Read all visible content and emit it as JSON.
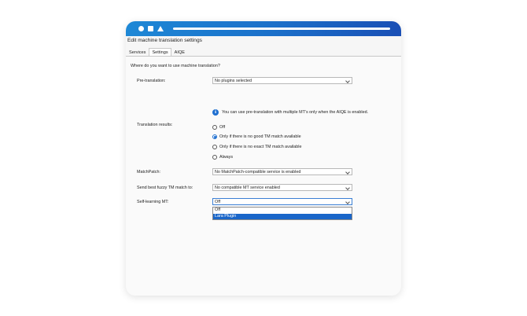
{
  "window": {
    "title": "Edit machine translation settings"
  },
  "tabs": [
    {
      "label": "Services"
    },
    {
      "label": "Settings"
    },
    {
      "label": "AIQE"
    }
  ],
  "question": "Where do you want to use machine translation?",
  "pretranslation": {
    "label": "Pre-translation:",
    "value": "No plugins selected"
  },
  "info": {
    "text": "You can use pre-translation with multiple MT’s only when the AIQE is enabled."
  },
  "translation_results": {
    "label": "Translation results:",
    "options": [
      {
        "label": "Off",
        "checked": false
      },
      {
        "label": "Only if there is no good TM match available",
        "checked": true
      },
      {
        "label": "Only if there is no exact TM match available",
        "checked": false
      },
      {
        "label": "Always",
        "checked": false
      }
    ]
  },
  "matchpatch": {
    "label": "MatchPatch:",
    "value": "No MatchPatch-compatible service is enabled"
  },
  "send_best_fuzzy": {
    "label": "Send best fuzzy TM match to:",
    "value": "No compatible MT service enabled"
  },
  "self_learning": {
    "label": "Self-learning MT:",
    "value": "Off",
    "options": [
      "Off",
      "Lara Plugin"
    ],
    "highlighted": "Lara Plugin"
  },
  "colors": {
    "titlebar_start": "#1e88d6",
    "titlebar_end": "#1a4fb5",
    "accent": "#1e6fd0",
    "highlight": "#1a66c9"
  }
}
